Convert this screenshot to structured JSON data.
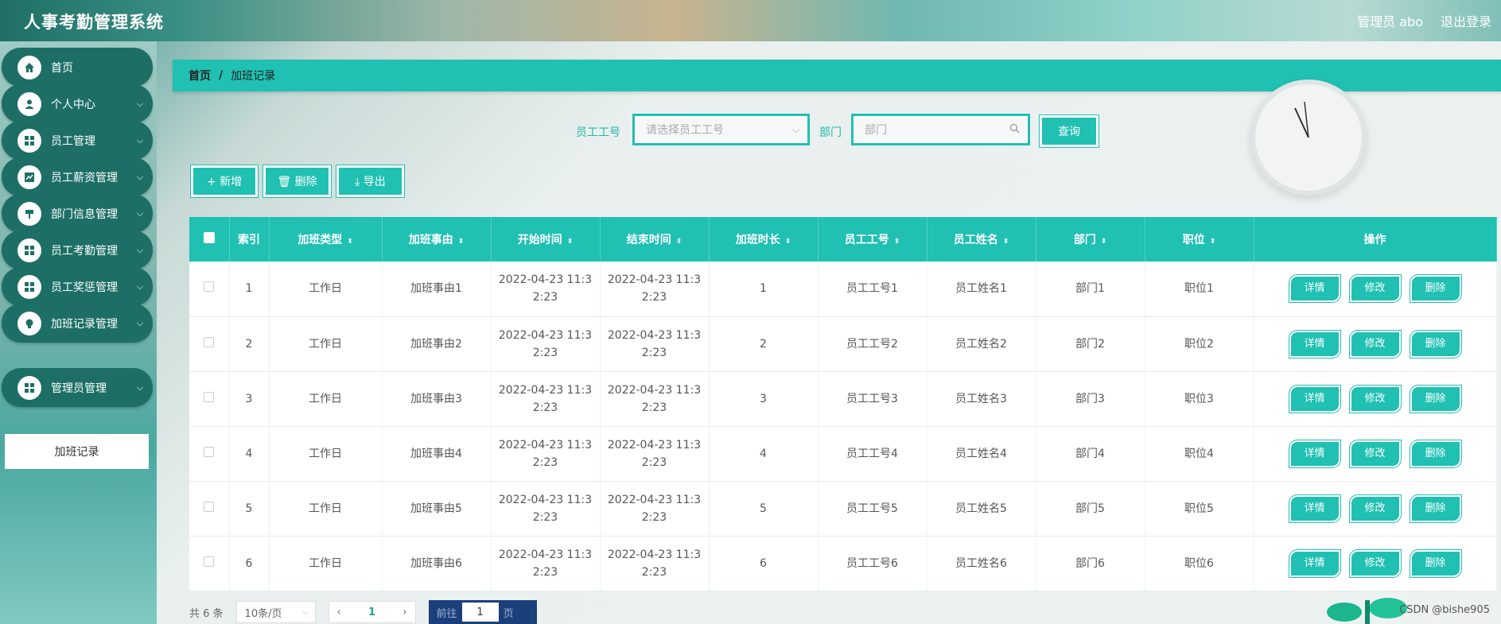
{
  "header": {
    "title": "人事考勤管理系统",
    "user": "管理员 abo",
    "logout": "退出登录"
  },
  "sidebar": {
    "items": [
      {
        "label": "首页",
        "icon": "home-icon",
        "has_chevron": false
      },
      {
        "label": "个人中心",
        "icon": "user-icon",
        "has_chevron": true
      },
      {
        "label": "员工管理",
        "icon": "grid-icon",
        "has_chevron": true
      },
      {
        "label": "员工薪资管理",
        "icon": "chart-icon",
        "has_chevron": true
      },
      {
        "label": "部门信息管理",
        "icon": "sign-icon",
        "has_chevron": true
      },
      {
        "label": "员工考勤管理",
        "icon": "grid-icon",
        "has_chevron": true
      },
      {
        "label": "员工奖惩管理",
        "icon": "grid-icon",
        "has_chevron": true
      },
      {
        "label": "加班记录管理",
        "icon": "bulb-icon",
        "has_chevron": true
      },
      {
        "label": "管理员管理",
        "icon": "grid-icon",
        "has_chevron": true
      }
    ],
    "submenu_active": "加班记录"
  },
  "breadcrumb": {
    "home": "首页",
    "separator": "/",
    "current": "加班记录"
  },
  "search": {
    "employee_no_label": "员工工号",
    "employee_no_placeholder": "请选择员工工号",
    "department_label": "部门",
    "department_placeholder": "部门",
    "query_button": "查询"
  },
  "toolbar": {
    "add": "+ 新增",
    "delete": "🗑 删除",
    "export": "⤓ 导出"
  },
  "table": {
    "headers": [
      "索引",
      "加班类型",
      "加班事由",
      "开始时间",
      "结束时间",
      "加班时长",
      "员工工号",
      "员工姓名",
      "部门",
      "职位",
      "操作"
    ],
    "actions": [
      "详情",
      "修改",
      "删除"
    ],
    "rows": [
      [
        "1",
        "工作日",
        "加班事由1",
        "2022-04-23 11:3",
        "2:23",
        "2022-04-23 11:3",
        "2:23",
        "1",
        "员工工号1",
        "员工姓名1",
        "部门1",
        "职位1"
      ],
      [
        "2",
        "工作日",
        "加班事由2",
        "2022-04-23 11:3",
        "2:23",
        "2022-04-23 11:3",
        "2:23",
        "2",
        "员工工号2",
        "员工姓名2",
        "部门2",
        "职位2"
      ],
      [
        "3",
        "工作日",
        "加班事由3",
        "2022-04-23 11:3",
        "2:23",
        "2022-04-23 11:3",
        "2:23",
        "3",
        "员工工号3",
        "员工姓名3",
        "部门3",
        "职位3"
      ],
      [
        "4",
        "工作日",
        "加班事由4",
        "2022-04-23 11:3",
        "2:23",
        "2022-04-23 11:3",
        "2:23",
        "4",
        "员工工号4",
        "员工姓名4",
        "部门4",
        "职位4"
      ],
      [
        "5",
        "工作日",
        "加班事由5",
        "2022-04-23 11:3",
        "2:23",
        "2022-04-23 11:3",
        "2:23",
        "5",
        "员工工号5",
        "员工姓名5",
        "部门5",
        "职位5"
      ],
      [
        "6",
        "工作日",
        "加班事由6",
        "2022-04-23 11:3",
        "2:23",
        "2022-04-23 11:3",
        "2:23",
        "6",
        "员工工号6",
        "员工姓名6",
        "部门6",
        "职位6"
      ]
    ]
  },
  "pagination": {
    "total": "共 6 条",
    "page_size": "10条/页",
    "current_page": "1",
    "goto_label": "前往",
    "goto_value": "1",
    "goto_suffix": "页"
  },
  "watermark": "CSDN @bishe905",
  "colors": {
    "accent": "#20c0b2",
    "sidebar_item": "#1d6f66"
  }
}
